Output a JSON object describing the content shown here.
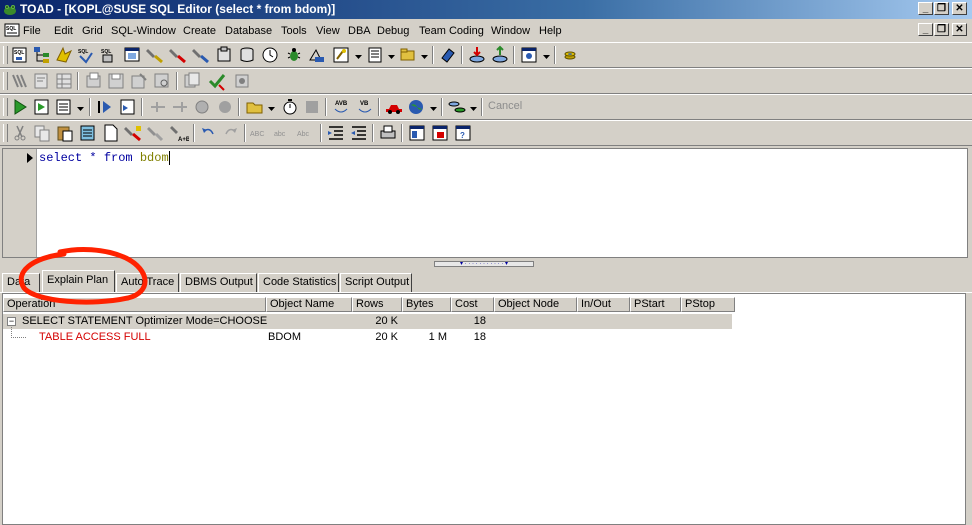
{
  "window": {
    "title": "TOAD - [KOPL@SUSE SQL Editor (select * from bdom)]",
    "controls": [
      "minimize",
      "restore",
      "close"
    ],
    "mdi_controls": [
      "minimize",
      "restore",
      "close"
    ]
  },
  "menu": {
    "items": [
      {
        "label": "File"
      },
      {
        "label": "Edit"
      },
      {
        "label": "Grid"
      },
      {
        "label": "SQL-Window"
      },
      {
        "label": "Create"
      },
      {
        "label": "Database"
      },
      {
        "label": "Tools"
      },
      {
        "label": "View"
      },
      {
        "label": "DBA"
      },
      {
        "label": "Debug"
      },
      {
        "label": "Team Coding"
      },
      {
        "label": "Window"
      },
      {
        "label": "Help"
      }
    ]
  },
  "toolbar": {
    "cancel_label": "Cancel"
  },
  "editor": {
    "sql_keyword_1": "select",
    "sql_star": "*",
    "sql_keyword_2": "from",
    "sql_table": "bdom"
  },
  "tabs": [
    {
      "label": "Data"
    },
    {
      "label": "Explain Plan",
      "active": true
    },
    {
      "label": "Auto Trace"
    },
    {
      "label": "DBMS Output"
    },
    {
      "label": "Code Statistics"
    },
    {
      "label": "Script Output"
    }
  ],
  "plan": {
    "columns": [
      "Operation",
      "Object Name",
      "Rows",
      "Bytes",
      "Cost",
      "Object Node",
      "In/Out",
      "PStart",
      "PStop"
    ],
    "rows": [
      {
        "operation": "SELECT STATEMENT Optimizer Mode=CHOOSE",
        "object_name": "",
        "rows": "20 K",
        "bytes": "",
        "cost": "18",
        "expander": "−"
      },
      {
        "operation": "TABLE ACCESS FULL",
        "object_name": "BDOM",
        "rows": "20 K",
        "bytes": "1 M",
        "cost": "18"
      }
    ]
  },
  "colors": {
    "highlight_circle": "#ff2200",
    "operation_child": "#d40000",
    "sql_keyword": "#0000a0",
    "sql_identifier": "#808000"
  }
}
